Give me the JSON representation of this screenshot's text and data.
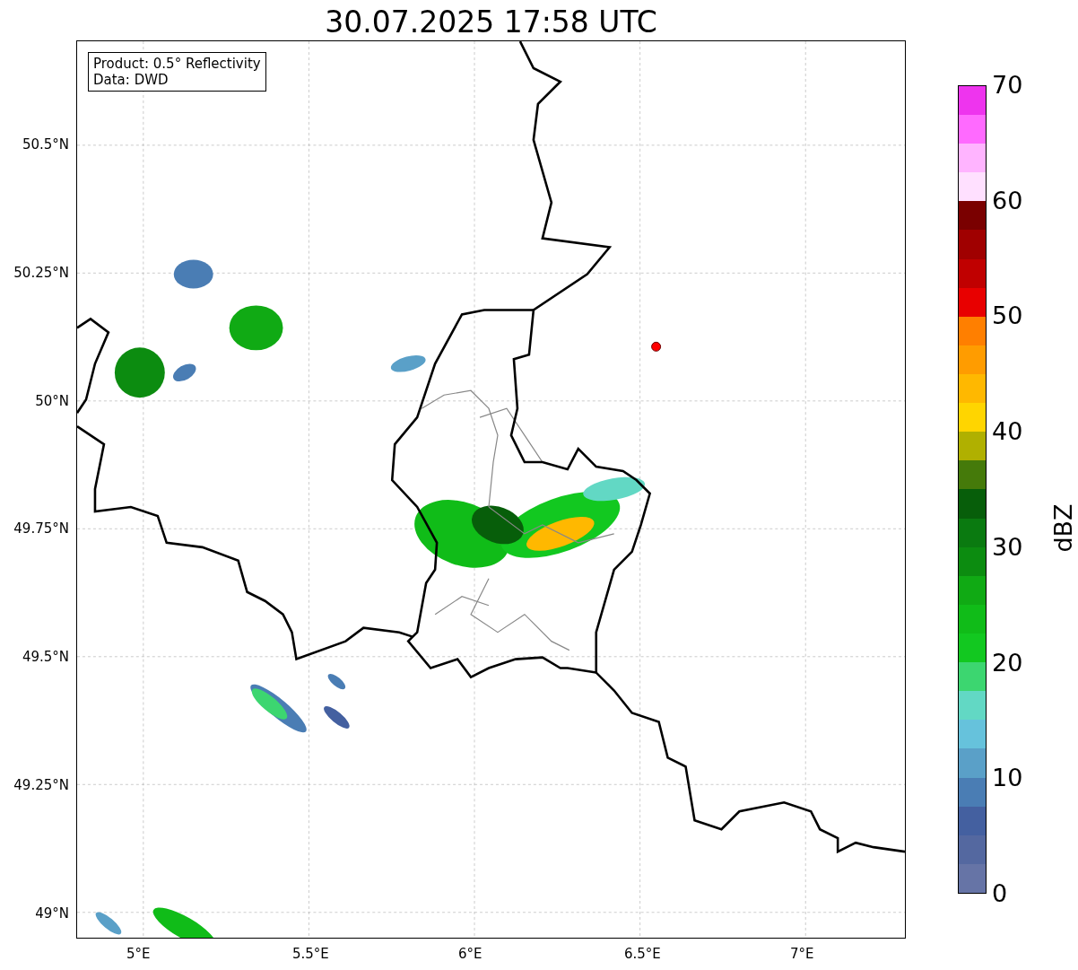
{
  "title": "30.07.2025 17:58 UTC",
  "map": {
    "legend": [
      "Product: 0.5° Reflectivity",
      "Data: DWD"
    ],
    "yticks": [
      "50.5°N",
      "50.25°N",
      "50°N",
      "49.75°N",
      "49.5°N",
      "49.25°N",
      "49°N"
    ],
    "xticks": [
      "5°E",
      "5.5°E",
      "6°E",
      "6.5°E",
      "7°E"
    ]
  },
  "colorbar": {
    "label": "dBZ",
    "ticks": [
      "70",
      "60",
      "50",
      "40",
      "30",
      "20",
      "10",
      "0"
    ]
  }
}
